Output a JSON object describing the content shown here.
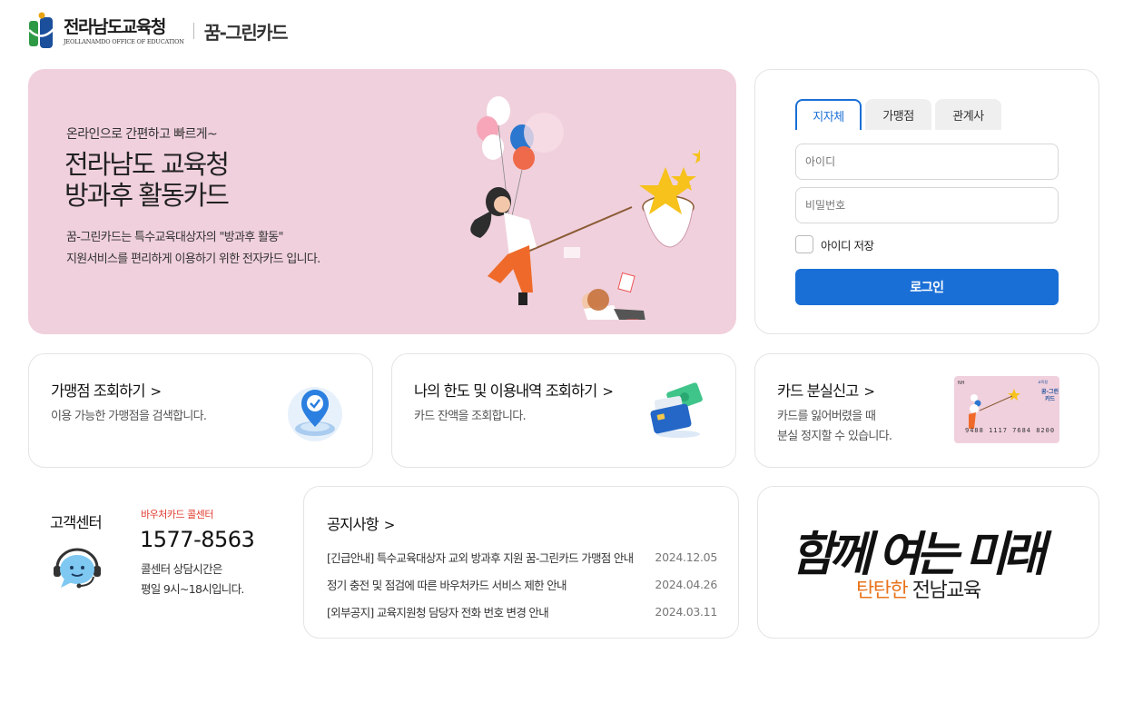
{
  "header": {
    "org_name": "전라남도교육청",
    "org_name_en": "JEOLLANAMDO OFFICE OF EDUCATION",
    "service_name": "꿈-그린카드"
  },
  "hero": {
    "subtitle": "온라인으로 간편하고 빠르게~",
    "title_line1": "전라남도 교육청",
    "title_line2": "방과후 활동카드",
    "desc_line1": "꿈-그린카드는 특수교육대상자의 \"방과후 활동\"",
    "desc_line2": "지원서비스를 편리하게 이용하기 위한 전자카드 입니다.",
    "bg_color": "#f0d0dc"
  },
  "login": {
    "tabs": [
      {
        "label": "지자체",
        "active": true
      },
      {
        "label": "가맹점",
        "active": false
      },
      {
        "label": "관계사",
        "active": false
      }
    ],
    "id_placeholder": "아이디",
    "pw_placeholder": "비밀번호",
    "save_id_label": "아이디 저장",
    "submit_label": "로그인",
    "accent_color": "#1a6fd6"
  },
  "cards": [
    {
      "title": "가맹점 조회하기",
      "desc_line1": "이용 가능한 가맹점을 검색합니다.",
      "desc_line2": "",
      "icon": "map-pin-icon"
    },
    {
      "title": "나의 한도 및 이용내역 조회하기",
      "desc_line1": "카드 잔액을 조회합니다.",
      "desc_line2": "",
      "icon": "card-money-icon"
    },
    {
      "title": "카드 분실신고",
      "desc_line1": "카드를 잃어버렸을 때",
      "desc_line2": "분실 정지할 수 있습니다.",
      "icon": "green-card-image",
      "card_number": "9488 1117 7684 8200"
    }
  ],
  "customer_center": {
    "title": "고객센터",
    "badge": "바우처카드 콜센터",
    "phone": "1577-8563",
    "hours_line1": "콜센터 상담시간은",
    "hours_line2": "평일 9시~18시입니다.",
    "icon": "headset-chat-icon"
  },
  "notices": {
    "title": "공지사항",
    "items": [
      {
        "text": "[긴급안내] 특수교육대상자 교외 방과후 지원 꿈-그린카드 가맹점 안내",
        "date": "2024.12.05"
      },
      {
        "text": "정기 충전 및 점검에 따른 바우처카드 서비스 제한 안내",
        "date": "2024.04.26"
      },
      {
        "text": "[외부공지] 교육지원청 담당자 전화 번호 변경 안내",
        "date": "2024.03.11"
      }
    ]
  },
  "slogan": {
    "handwritten": "함께 여는 미래",
    "accent": "탄탄한",
    "rest": " 전남교육",
    "accent_color": "#e8741c"
  }
}
